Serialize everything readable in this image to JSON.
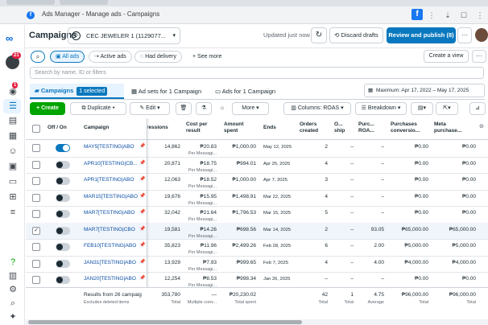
{
  "browser": {
    "tab_title": "Ads Manager - Manage ads - Campaigns"
  },
  "header": {
    "title": "Campaigns",
    "account": "CEC JEWELER 1 (1129077...",
    "updated": "Updated just now",
    "discard": "Discard drafts",
    "publish": "Review and publish (8)"
  },
  "rail": {
    "notification_count": "21",
    "alert_count": "1"
  },
  "filters": {
    "all_ads": "All ads",
    "active_ads": "Active ads",
    "had_delivery": "Had delivery",
    "see_more": "+ See more",
    "create_view": "Create a view"
  },
  "search": {
    "placeholder": "Search by name, ID or filters"
  },
  "tabs": {
    "campaigns": "Campaigns",
    "selected": "1 selected",
    "ad_sets": "Ad sets for 1 Campaign",
    "ads": "Ads for 1 Campaign",
    "date_range": "Maximum: Apr 17, 2022 – May 17, 2025"
  },
  "toolbar": {
    "create": "+ Create",
    "duplicate": "Duplicate",
    "edit": "Edit",
    "more": "More",
    "columns": "Columns: ROAS",
    "breakdown": "Breakdown"
  },
  "table": {
    "headers": {
      "off_on": "Off / On",
      "campaign": "Campaign",
      "impressions": "ressions",
      "cost_per_result": "Cost per result",
      "amount_spent": "Amount spent",
      "ends": "Ends",
      "orders_created": "Orders created",
      "ownership": "O... ship",
      "purchase_roas": "Purc... ROA...",
      "purchases_conversion": "Purchases conversio...",
      "meta_purchase": "Meta purchase..."
    },
    "rows": [
      {
        "on": true,
        "selected": false,
        "name": "MAY5[TESTING|ABO",
        "impressions": "14,862",
        "cost": "₱20.83",
        "cost_sub": "Per Messagi...",
        "spent": "₱1,000.00",
        "ends": "May 12, 2025",
        "orders": "2",
        "own": "–",
        "roas": "–",
        "purch_conv": "₱0.00",
        "meta": "₱0.00"
      },
      {
        "on": false,
        "selected": false,
        "name": "APR10[TESTING|CB...",
        "impressions": "20,871",
        "cost": "₱18.75",
        "cost_sub": "Per Messagi...",
        "spent": "₱994.01",
        "ends": "Apr 25, 2025",
        "orders": "4",
        "own": "–",
        "roas": "–",
        "purch_conv": "₱0.00",
        "meta": "₱0.00"
      },
      {
        "on": false,
        "selected": false,
        "name": "APR1[TESTING|ABO",
        "impressions": "12,063",
        "cost": "₱18.52",
        "cost_sub": "Per Messagi...",
        "spent": "₱1,000.00",
        "ends": "Apr 7, 2025",
        "orders": "3",
        "own": "–",
        "roas": "–",
        "purch_conv": "₱0.00",
        "meta": "₱0.00"
      },
      {
        "on": false,
        "selected": false,
        "name": "MAR15[TESTING|ABO",
        "impressions": "19,676",
        "cost": "₱15.95",
        "cost_sub": "Per Messagi...",
        "spent": "₱1,498.91",
        "ends": "Mar 22, 2025",
        "orders": "4",
        "own": "–",
        "roas": "–",
        "purch_conv": "₱0.00",
        "meta": "₱0.00"
      },
      {
        "on": false,
        "selected": false,
        "name": "MAR7[TESTING|ABO",
        "impressions": "32,042",
        "cost": "₱21.64",
        "cost_sub": "Per Messagi...",
        "spent": "₱1,796.53",
        "ends": "Mar 15, 2025",
        "orders": "5",
        "own": "–",
        "roas": "–",
        "purch_conv": "₱0.00",
        "meta": "₱0.00"
      },
      {
        "on": false,
        "selected": true,
        "name": "MAR7[TESTING|CBO",
        "impressions": "19,581",
        "cost": "₱14.26",
        "cost_sub": "Per Messagi...",
        "spent": "₱698.56",
        "ends": "Mar 14, 2025",
        "orders": "2",
        "own": "–",
        "roas": "93.05",
        "purch_conv": "₱65,000.00",
        "meta": "₱65,000.00"
      },
      {
        "on": false,
        "selected": false,
        "name": "FEB10[TESTING|ABO",
        "impressions": "35,823",
        "cost": "₱11.96",
        "cost_sub": "Per Messagi...",
        "spent": "₱2,499.26",
        "ends": "Feb 28, 2025",
        "orders": "6",
        "own": "–",
        "roas": "2.00",
        "purch_conv": "₱5,000.00",
        "meta": "₱5,000.00"
      },
      {
        "on": false,
        "selected": false,
        "name": "JAN31[TESTING|ABO",
        "impressions": "13,929",
        "cost": "₱7.93",
        "cost_sub": "Per Messagi...",
        "spent": "₱999.65",
        "ends": "Feb 7, 2025",
        "orders": "4",
        "own": "–",
        "roas": "4.00",
        "purch_conv": "₱4,000.00",
        "meta": "₱4,000.00"
      },
      {
        "on": false,
        "selected": false,
        "name": "JAN20[TESTING|ABO",
        "impressions": "12,254",
        "cost": "₱8.53",
        "cost_sub": "Per Messagi...",
        "spent": "₱998.34",
        "ends": "Jan 26, 2025",
        "orders": "–",
        "own": "–",
        "roas": "–",
        "purch_conv": "₱0.00",
        "meta": "₱0.00"
      }
    ],
    "totals": {
      "label": "Results from 26 campaig",
      "sub": "Excludes deleted items",
      "impressions": "353,780",
      "impressions_sub": "Total",
      "cost": "—",
      "cost_sub": "Multiple conv...",
      "spent": "₱20,230.02",
      "spent_sub": "Total spent",
      "orders": "42",
      "orders_sub": "Total",
      "own": "1",
      "own_sub": "Total",
      "roas": "4.75",
      "roas_sub": "Average",
      "purch_conv": "₱96,000.00",
      "purch_conv_sub": "Total",
      "meta": "₱96,000.00",
      "meta_sub": "Total"
    }
  }
}
